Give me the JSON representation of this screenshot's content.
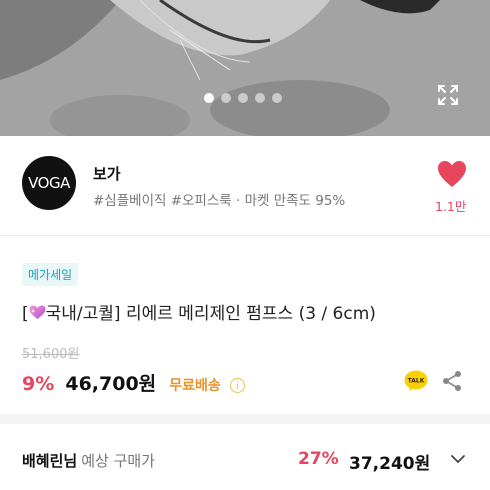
{
  "carousel": {
    "dots": [
      true,
      false,
      false,
      false,
      false
    ]
  },
  "seller": {
    "logo_text": "VOGA",
    "name": "보가",
    "meta": "#심플베이직 #오피스룩 · 마켓 만족도 95%",
    "like_count": "1.1만"
  },
  "product": {
    "badge": "메가세일",
    "title_prefix": "[",
    "title_rest": "국내/고퀄] 리에르 메리제인 펌프스 (3 / 6cm)",
    "original_price": "51,600원",
    "discount": "9%",
    "price": "46,700원",
    "shipping": "무료배송",
    "info": "i"
  },
  "member": {
    "name": "배혜린님",
    "label": "예상 구매가",
    "discount": "27%",
    "price": "37,240원"
  },
  "colors": {
    "accent_red": "#e8455f",
    "badge_teal": "#1aa3b8",
    "shipping_orange": "#e8922a",
    "kakao_yellow": "#f7d100"
  },
  "icons": [
    "expand-icon",
    "heart-icon",
    "info-icon",
    "kakaotalk-icon",
    "share-icon",
    "chevron-down-icon"
  ]
}
